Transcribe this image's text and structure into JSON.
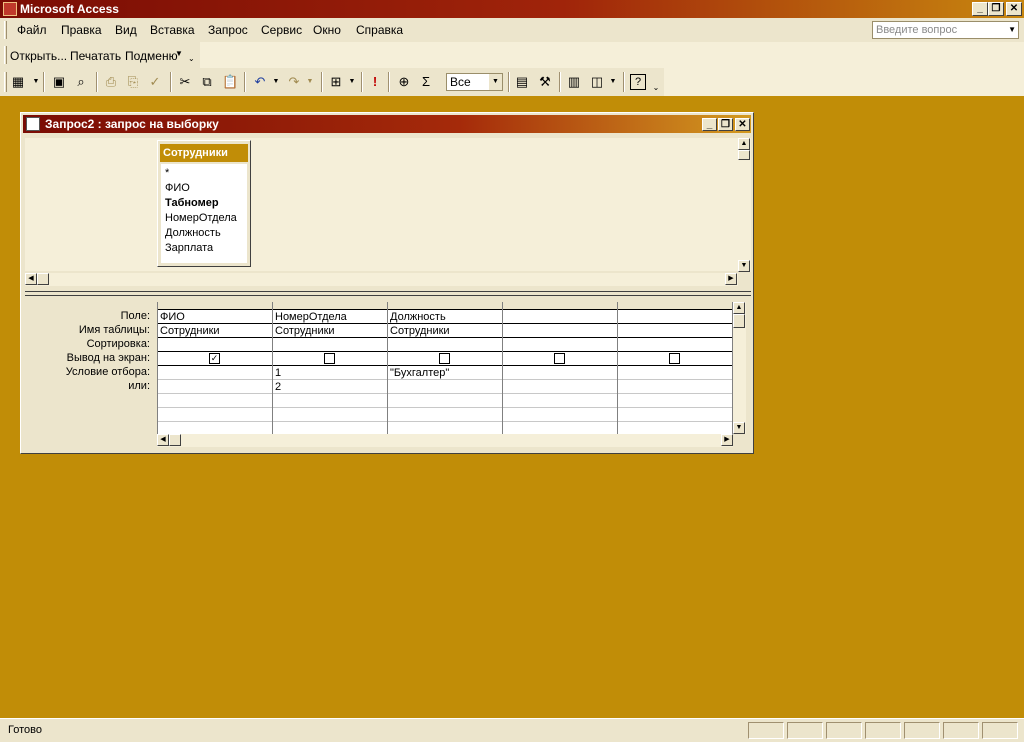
{
  "app": {
    "title": "Microsoft Access",
    "icon": "access-key-icon"
  },
  "window_buttons": {
    "minimize": "_",
    "restore": "❐",
    "close": "✕"
  },
  "menu": [
    {
      "label": "Файл"
    },
    {
      "label": "Правка"
    },
    {
      "label": "Вид"
    },
    {
      "label": "Вставка"
    },
    {
      "label": "Запрос"
    },
    {
      "label": "Сервис"
    },
    {
      "label": "Окно"
    },
    {
      "label": "Справка"
    }
  ],
  "ask_box": {
    "placeholder": "Введите вопрос"
  },
  "toolbar_web": {
    "open": "Открыть...",
    "print": "Печатать",
    "submenu": "Подменю"
  },
  "toolbar_main": {
    "top_values": "Все",
    "icons": [
      "view-icon",
      "save-icon",
      "search-icon",
      "print-icon",
      "print-preview-icon",
      "spelling-icon",
      "cut-icon",
      "copy-icon",
      "paste-icon",
      "undo-icon",
      "redo-icon",
      "query-type-icon",
      "run-icon",
      "show-table-icon",
      "totals-icon",
      "properties-icon",
      "build-icon",
      "database-window-icon",
      "new-object-icon",
      "help-icon"
    ]
  },
  "query_window": {
    "title": "Запрос2 : запрос на выборку",
    "table": {
      "name": "Сотрудники",
      "fields": [
        "*",
        "ФИО",
        "Табномер",
        "НомерОтдела",
        "Должность",
        "Зарплата"
      ],
      "key_field": "Табномер"
    },
    "grid": {
      "row_labels": [
        "Поле:",
        "Имя таблицы:",
        "Сортировка:",
        "Вывод на экран:",
        "Условие отбора:",
        "или:"
      ],
      "columns": [
        {
          "field": "ФИО",
          "table": "Сотрудники",
          "sort": "",
          "show": true,
          "criteria": "",
          "or": ""
        },
        {
          "field": "НомерОтдела",
          "table": "Сотрудники",
          "sort": "",
          "show": false,
          "criteria": "1",
          "or": "2"
        },
        {
          "field": "Должность",
          "table": "Сотрудники",
          "sort": "",
          "show": false,
          "criteria": "\"Бухгалтер\"",
          "or": ""
        },
        {
          "field": "",
          "table": "",
          "sort": "",
          "show": false,
          "criteria": "",
          "or": ""
        },
        {
          "field": "",
          "table": "",
          "sort": "",
          "show": false,
          "criteria": "",
          "or": ""
        }
      ]
    }
  },
  "status": {
    "text": "Готово"
  },
  "colors": {
    "workspace": "#C18D07",
    "title_start": "#7A0C04",
    "title_end": "#C8870F",
    "chrome": "#ECE5CC"
  }
}
